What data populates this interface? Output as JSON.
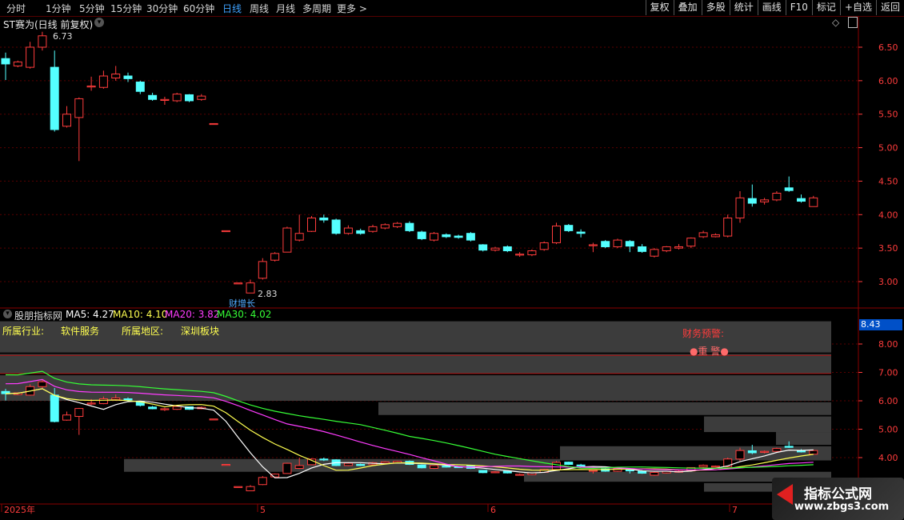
{
  "toolbar": {
    "periods": [
      "分时",
      "1分钟",
      "5分钟",
      "15分钟",
      "30分钟",
      "60分钟",
      "日线",
      "周线",
      "月线",
      "多周期",
      "更多 >"
    ],
    "active_period": "日线",
    "right_buttons": [
      "复权",
      "叠加",
      "多股",
      "统计",
      "画线",
      "F10",
      "标记",
      "+自选",
      "返回"
    ]
  },
  "main_panel": {
    "title": "ST赛为(日线 前复权)",
    "high_marker": "6.73",
    "low_marker": "2.83",
    "event_label": "财增长",
    "price_ticks": [
      "6.50",
      "6.00",
      "5.50",
      "5.00",
      "4.50",
      "4.00",
      "3.50",
      "3.00"
    ]
  },
  "indicator_panel": {
    "name": "股朋指标网",
    "ma5": "MA5: 4.27",
    "ma10": "MA10: 4.10",
    "ma20": "MA20: 3.82",
    "ma30": "MA30: 4.02",
    "industry_label": "所属行业:",
    "industry_value": "软件服务",
    "region_label": "所属地区:",
    "region_value": "深圳板块",
    "warning_label": "财务预警:",
    "warning_value": "重 警",
    "current_value": "8.43",
    "ticks": [
      "8.00",
      "7.00",
      "6.00",
      "5.00",
      "4.00"
    ]
  },
  "date_axis": [
    "2025年",
    "5",
    "6",
    "7"
  ],
  "watermark": {
    "line1": "指标公式网",
    "line2": "www.zbgs3.com"
  },
  "colors": {
    "up": "#ff3c3c",
    "down": "#54ffff",
    "ma5": "#ffffff",
    "ma10": "#ffff50",
    "ma20": "#ff3cff",
    "ma30": "#36ff36",
    "active": "#3fa2ff"
  },
  "chart_data": {
    "type": "candlestick",
    "series": [
      {
        "name": "price",
        "candles": [
          {
            "o": 6.33,
            "c": 6.25,
            "h": 6.42,
            "l": 6.01
          },
          {
            "o": 6.22,
            "c": 6.28,
            "h": 6.3,
            "l": 6.2
          },
          {
            "o": 6.2,
            "c": 6.5,
            "h": 6.58,
            "l": 6.18
          },
          {
            "o": 6.5,
            "c": 6.67,
            "h": 6.73,
            "l": 6.45
          },
          {
            "o": 6.2,
            "c": 5.27,
            "h": 6.45,
            "l": 5.24
          },
          {
            "o": 5.32,
            "c": 5.5,
            "h": 5.62,
            "l": 5.3
          },
          {
            "o": 5.45,
            "c": 5.73,
            "h": 5.75,
            "l": 4.8
          },
          {
            "o": 5.92,
            "c": 5.92,
            "h": 6.06,
            "l": 5.85
          },
          {
            "o": 5.9,
            "c": 6.07,
            "h": 6.15,
            "l": 5.88
          },
          {
            "o": 6.04,
            "c": 6.1,
            "h": 6.22,
            "l": 6.0
          },
          {
            "o": 6.07,
            "c": 6.03,
            "h": 6.12,
            "l": 5.98
          },
          {
            "o": 5.98,
            "c": 5.84,
            "h": 6.0,
            "l": 5.8
          },
          {
            "o": 5.78,
            "c": 5.72,
            "h": 5.82,
            "l": 5.7
          },
          {
            "o": 5.72,
            "c": 5.72,
            "h": 5.76,
            "l": 5.64
          },
          {
            "o": 5.7,
            "c": 5.8,
            "h": 5.82,
            "l": 5.68
          },
          {
            "o": 5.79,
            "c": 5.7,
            "h": 5.8,
            "l": 5.68
          },
          {
            "o": 5.72,
            "c": 5.77,
            "h": 5.8,
            "l": 5.7
          },
          {
            "o": 5.36,
            "c": 5.36,
            "h": 5.36,
            "l": 5.36
          },
          {
            "o": 3.76,
            "c": 3.76,
            "h": 3.76,
            "l": 3.76
          },
          {
            "o": 2.98,
            "c": 2.98,
            "h": 2.98,
            "l": 2.98
          },
          {
            "o": 2.83,
            "c": 2.98,
            "h": 3.03,
            "l": 2.83
          },
          {
            "o": 3.05,
            "c": 3.3,
            "h": 3.35,
            "l": 3.03
          },
          {
            "o": 3.32,
            "c": 3.42,
            "h": 3.44,
            "l": 3.3
          },
          {
            "o": 3.44,
            "c": 3.8,
            "h": 3.82,
            "l": 3.44
          },
          {
            "o": 3.62,
            "c": 3.72,
            "h": 4.0,
            "l": 3.6
          },
          {
            "o": 3.75,
            "c": 3.95,
            "h": 3.98,
            "l": 3.74
          },
          {
            "o": 3.95,
            "c": 3.92,
            "h": 4.0,
            "l": 3.88
          },
          {
            "o": 3.92,
            "c": 3.72,
            "h": 3.94,
            "l": 3.7
          },
          {
            "o": 3.72,
            "c": 3.8,
            "h": 3.84,
            "l": 3.7
          },
          {
            "o": 3.76,
            "c": 3.72,
            "h": 3.79,
            "l": 3.7
          },
          {
            "o": 3.75,
            "c": 3.82,
            "h": 3.85,
            "l": 3.73
          },
          {
            "o": 3.8,
            "c": 3.85,
            "h": 3.87,
            "l": 3.78
          },
          {
            "o": 3.82,
            "c": 3.87,
            "h": 3.89,
            "l": 3.8
          },
          {
            "o": 3.87,
            "c": 3.76,
            "h": 3.9,
            "l": 3.74
          },
          {
            "o": 3.74,
            "c": 3.64,
            "h": 3.76,
            "l": 3.62
          },
          {
            "o": 3.62,
            "c": 3.72,
            "h": 3.74,
            "l": 3.6
          },
          {
            "o": 3.7,
            "c": 3.67,
            "h": 3.72,
            "l": 3.65
          },
          {
            "o": 3.68,
            "c": 3.66,
            "h": 3.7,
            "l": 3.64
          },
          {
            "o": 3.72,
            "c": 3.62,
            "h": 3.74,
            "l": 3.6
          },
          {
            "o": 3.55,
            "c": 3.47,
            "h": 3.56,
            "l": 3.45
          },
          {
            "o": 3.47,
            "c": 3.5,
            "h": 3.52,
            "l": 3.45
          },
          {
            "o": 3.52,
            "c": 3.46,
            "h": 3.54,
            "l": 3.44
          },
          {
            "o": 3.4,
            "c": 3.41,
            "h": 3.44,
            "l": 3.37
          },
          {
            "o": 3.4,
            "c": 3.46,
            "h": 3.48,
            "l": 3.38
          },
          {
            "o": 3.48,
            "c": 3.58,
            "h": 3.6,
            "l": 3.46
          },
          {
            "o": 3.58,
            "c": 3.83,
            "h": 3.88,
            "l": 3.56
          },
          {
            "o": 3.84,
            "c": 3.76,
            "h": 3.86,
            "l": 3.74
          },
          {
            "o": 3.74,
            "c": 3.72,
            "h": 3.78,
            "l": 3.66
          },
          {
            "o": 3.55,
            "c": 3.55,
            "h": 3.58,
            "l": 3.44
          },
          {
            "o": 3.6,
            "c": 3.52,
            "h": 3.62,
            "l": 3.5
          },
          {
            "o": 3.52,
            "c": 3.62,
            "h": 3.64,
            "l": 3.5
          },
          {
            "o": 3.6,
            "c": 3.53,
            "h": 3.62,
            "l": 3.44
          },
          {
            "o": 3.52,
            "c": 3.45,
            "h": 3.56,
            "l": 3.43
          },
          {
            "o": 3.38,
            "c": 3.48,
            "h": 3.5,
            "l": 3.36
          },
          {
            "o": 3.46,
            "c": 3.52,
            "h": 3.53,
            "l": 3.44
          },
          {
            "o": 3.5,
            "c": 3.52,
            "h": 3.56,
            "l": 3.48
          },
          {
            "o": 3.53,
            "c": 3.65,
            "h": 3.66,
            "l": 3.5
          },
          {
            "o": 3.67,
            "c": 3.73,
            "h": 3.76,
            "l": 3.65
          },
          {
            "o": 3.67,
            "c": 3.7,
            "h": 3.72,
            "l": 3.66
          },
          {
            "o": 3.68,
            "c": 3.95,
            "h": 4.0,
            "l": 3.66
          },
          {
            "o": 3.95,
            "c": 4.25,
            "h": 4.35,
            "l": 3.88
          },
          {
            "o": 4.24,
            "c": 4.17,
            "h": 4.45,
            "l": 4.12
          },
          {
            "o": 4.19,
            "c": 4.22,
            "h": 4.25,
            "l": 4.15
          },
          {
            "o": 4.22,
            "c": 4.32,
            "h": 4.35,
            "l": 4.2
          },
          {
            "o": 4.4,
            "c": 4.36,
            "h": 4.57,
            "l": 4.34
          },
          {
            "o": 4.24,
            "c": 4.2,
            "h": 4.3,
            "l": 4.18
          },
          {
            "o": 4.12,
            "c": 4.25,
            "h": 4.28,
            "l": 4.12
          }
        ]
      }
    ],
    "ylim": [
      2.65,
      6.85
    ],
    "x_ticks": [
      "2025年",
      "5",
      "6",
      "7"
    ]
  }
}
